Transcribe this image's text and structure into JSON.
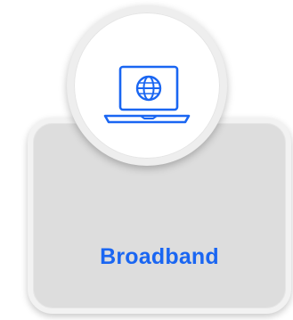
{
  "tile": {
    "label": "Broadband",
    "icon": "laptop-globe-icon",
    "accent_color": "#1a66f2"
  }
}
